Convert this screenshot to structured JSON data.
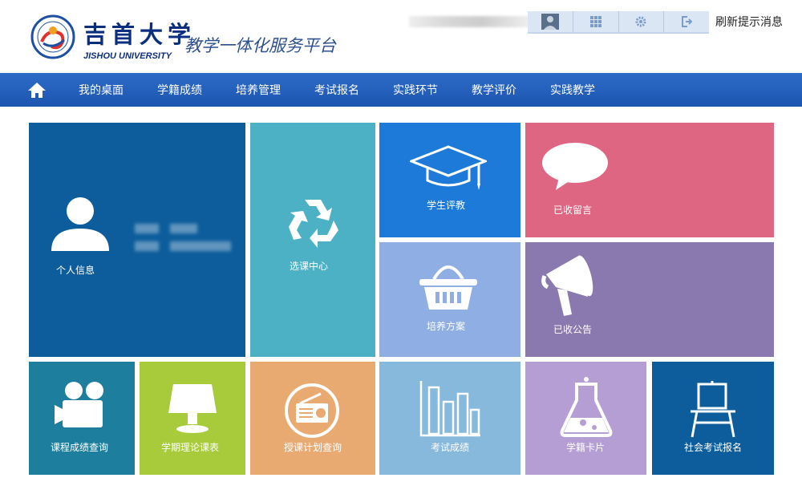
{
  "header": {
    "school_name_cn": "吉首大学",
    "school_name_en": "JISHOU UNIVERSITY",
    "platform_title": "教学一体化服务平台",
    "refresh_label": "刷新提示消息"
  },
  "nav": {
    "items": [
      {
        "label": "我的桌面"
      },
      {
        "label": "学籍成绩"
      },
      {
        "label": "培养管理"
      },
      {
        "label": "考试报名"
      },
      {
        "label": "实践环节"
      },
      {
        "label": "教学评价"
      },
      {
        "label": "实践教学"
      }
    ]
  },
  "tiles": {
    "personal": {
      "label": "个人信息",
      "color": "#0d5d9c"
    },
    "course_select": {
      "label": "选课中心",
      "color": "#4db1c6"
    },
    "student_eval": {
      "label": "学生评教",
      "color": "#1e7ad9"
    },
    "received_msg": {
      "label": "已收留言",
      "color": "#de6683"
    },
    "training_plan": {
      "label": "培养方案",
      "color": "#8faee3"
    },
    "received_notice": {
      "label": "已收公告",
      "color": "#8a79ae"
    },
    "grade_query": {
      "label": "课程成绩查询",
      "color": "#1d7f9d"
    },
    "timetable": {
      "label": "学期理论课表",
      "color": "#a7cb3b"
    },
    "teaching_plan": {
      "label": "授课计划查询",
      "color": "#e9aa72"
    },
    "exam_results": {
      "label": "考试成绩",
      "color": "#86b9dc"
    },
    "student_card": {
      "label": "学籍卡片",
      "color": "#b59ed4"
    },
    "social_exam": {
      "label": "社会考试报名",
      "color": "#0d5d9c"
    }
  }
}
